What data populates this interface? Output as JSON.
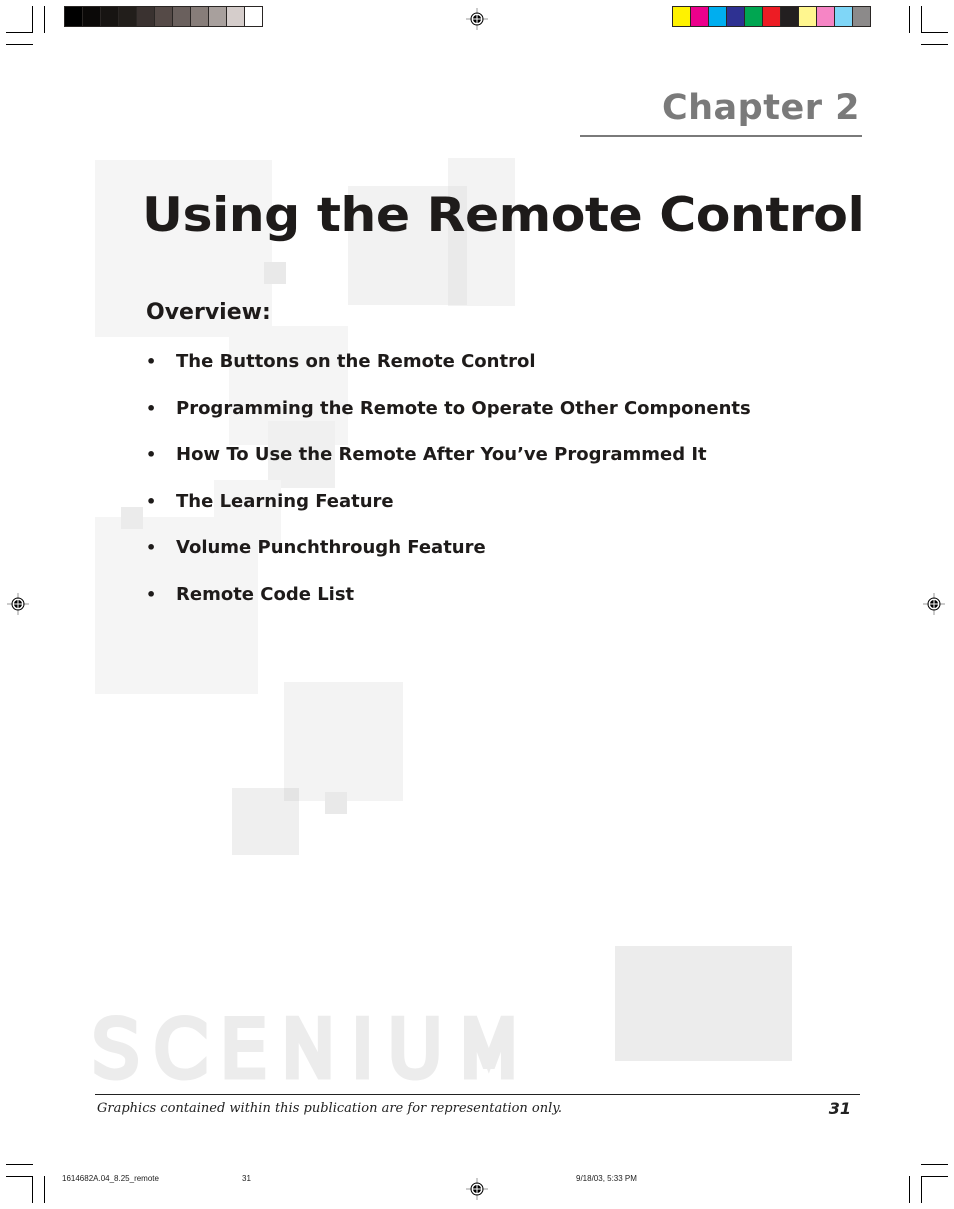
{
  "printer_marks": {
    "grayscale_swatches": [
      "#000000",
      "#0b0908",
      "#171412",
      "#221e1b",
      "#3a3230",
      "#554a47",
      "#6a605d",
      "#877d79",
      "#a8a09d",
      "#d5cdcb",
      "#ffffff"
    ],
    "color_swatches": [
      "#fff200",
      "#ec008c",
      "#00aeef",
      "#2e3192",
      "#00a651",
      "#ed1c24",
      "#231f20",
      "#fff68f",
      "#f685c5",
      "#7fd6f7",
      "#8c8a8a"
    ]
  },
  "header": {
    "chapter_label": "Chapter 2"
  },
  "title": "Using the Remote Control",
  "overview": {
    "heading": "Overview:",
    "bullet": "•",
    "items": [
      "The Buttons on the Remote Control",
      "Programming the Remote to Operate Other Components",
      "How To Use the Remote After You’ve Programmed It",
      "The Learning Feature",
      "Volume Punchthrough Feature",
      "Remote Code List"
    ]
  },
  "brand_watermark": "SCENIUM",
  "footer": {
    "note": "Graphics contained within this publication are for representation only.",
    "page_number": "31"
  },
  "slug": {
    "file_name": "1614682A.04_8.25_remote",
    "page": "31",
    "datetime": "9/18/03, 5:33 PM"
  },
  "colors": {
    "title": "#1e1b1a",
    "chapter": "#7a7a7a",
    "background_square": "#f3f3f3"
  }
}
